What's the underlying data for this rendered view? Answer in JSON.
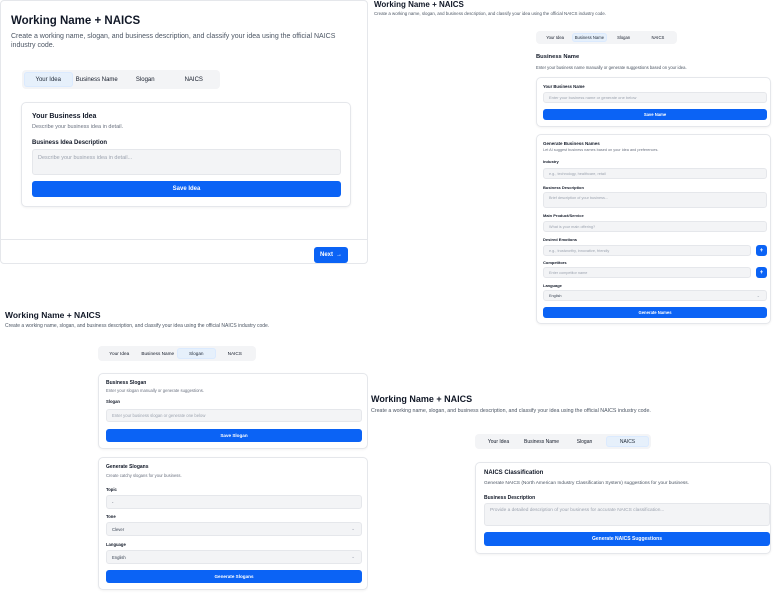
{
  "app": {
    "title": "Working Name + NAICS",
    "subtitle": "Create a working name, slogan, and business description, and classify your idea using the official NAICS industry code."
  },
  "tabs": [
    "Your Idea",
    "Business Name",
    "Slogan",
    "NAICS"
  ],
  "colors": {
    "accent": "#0b63f5",
    "active_tab": "#e6f0fb"
  },
  "idea": {
    "card_title": "Your Business Idea",
    "card_desc": "Describe your business idea in detail.",
    "field_label": "Business Idea Description",
    "placeholder": "Describe your business idea in detail...",
    "save_label": "Save Idea",
    "next_label": "Next",
    "next_icon": "→"
  },
  "name": {
    "section_title": "Business Name",
    "section_desc": "Enter your business name manually or generate suggestions based on your idea.",
    "field_label": "Your Business Name",
    "placeholder": "Enter your business name or generate one below",
    "save_label": "Save Name",
    "gen_title": "Generate Business Names",
    "gen_desc": "Let AI suggest business names based on your idea and preferences.",
    "industry_label": "Industry",
    "industry_placeholder": "e.g., technology, healthcare, retail",
    "desc_label": "Business Description",
    "desc_placeholder": "Brief description of your business...",
    "product_label": "Main Product/Service",
    "product_placeholder": "What is your main offering?",
    "emotions_label": "Desired Emotions",
    "emotions_placeholder": "e.g., trustworthy, innovative, friendly",
    "competitors_label": "Competitors",
    "competitors_placeholder": "Enter competitor name",
    "language_label": "Language",
    "language_value": "English",
    "plus_icon": "+",
    "generate_label": "Generate Names"
  },
  "slogan": {
    "card_title": "Business Slogan",
    "card_desc": "Enter your slogan manually or generate suggestions.",
    "field_label": "Slogan",
    "placeholder": "Enter your business slogan or generate one below",
    "save_label": "Save Slogan",
    "gen_title": "Generate Slogans",
    "gen_desc": "Create catchy slogans for your business.",
    "topic_label": "Topic",
    "topic_value": "-",
    "tone_label": "Tone",
    "tone_value": "Clever",
    "language_label": "Language",
    "language_value": "English",
    "generate_label": "Generate Slogans"
  },
  "naics": {
    "card_title": "NAICS Classification",
    "card_desc": "Generate NAICS (North American Industry Classification System) suggestions for your business.",
    "field_label": "Business Description",
    "placeholder": "Provide a detailed description of your business for accurate NAICS classification...",
    "generate_label": "Generate NAICS Suggestions"
  }
}
